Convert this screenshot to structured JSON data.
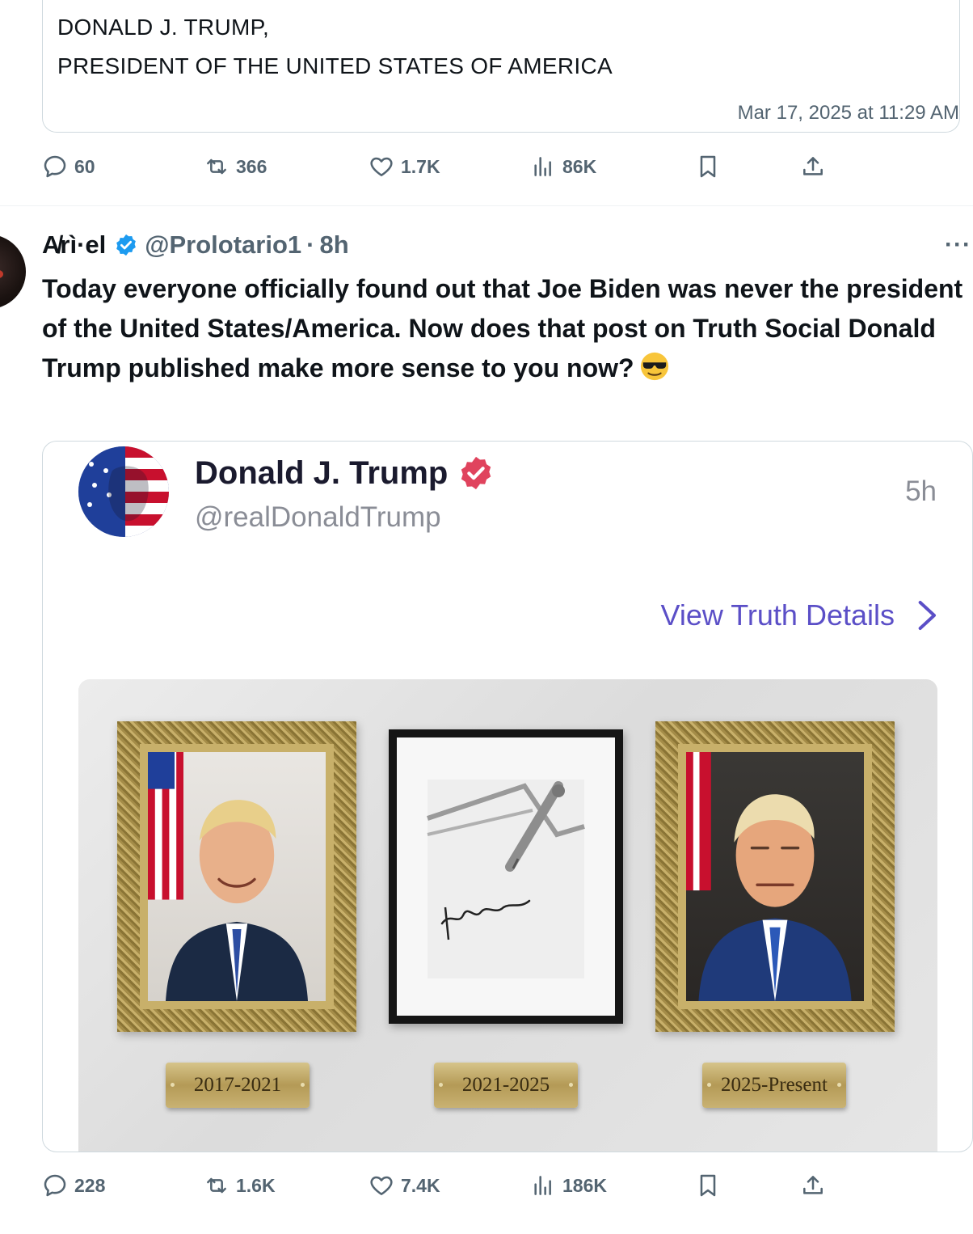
{
  "quoted_post": {
    "line1": "DONALD J. TRUMP,",
    "line2": "PRESIDENT OF THE UNITED STATES OF AMERICA",
    "timestamp": "Mar 17, 2025 at 11:29 AM"
  },
  "top_actions": {
    "replies": "60",
    "reposts": "366",
    "likes": "1.7K",
    "views": "86K"
  },
  "tweet": {
    "name": "A̸rì·el",
    "handle": "@Prolotario1",
    "separator": "·",
    "time": "8h",
    "more": "···",
    "text": "Today everyone officially found out that Joe Biden was never the president of the United States/America. Now does that post on Truth Social Donald Trump published make more sense to you now?"
  },
  "media_card": {
    "author_name": "Donald J. Trump",
    "author_handle": "@realDonaldTrump",
    "time": "5h",
    "view_details": "View Truth Details",
    "plaques": [
      "2017-2021",
      "2021-2025",
      "2025-Present"
    ]
  },
  "bottom_actions": {
    "replies": "228",
    "reposts": "1.6K",
    "likes": "7.4K",
    "views": "186K"
  },
  "colors": {
    "text_primary": "#0f1419",
    "text_secondary": "#536471",
    "verified_blue": "#1d9bf0",
    "truth_badge": "#e0435d",
    "link_purple": "#5b4fc7"
  }
}
